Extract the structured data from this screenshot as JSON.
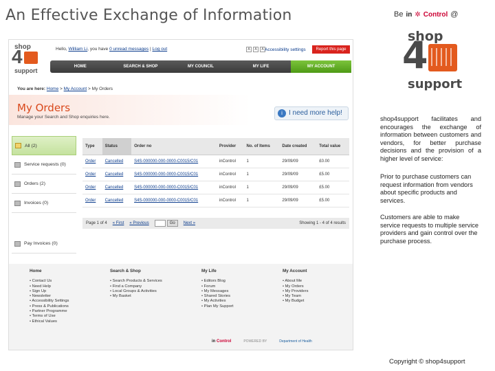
{
  "slide": {
    "title": "An Effective Exchange of Information",
    "be_prefix": "Be",
    "be_brand_in": "in",
    "be_brand_control": "Control",
    "be_suffix": "@",
    "logo_shop": "shop",
    "logo_four": "4",
    "logo_support": "support",
    "paragraphs": [
      "shop4support facilitates and encourages the exchange of information between customers and vendors, for better purchase decisions and the provision of a higher level of service:",
      "Prior to purchase customers can request information from vendors about specific products and services.",
      "Customers are able to make service requests to multiple service providers and gain control over the purchase process."
    ],
    "copyright": "Copyright © shop4support"
  },
  "site": {
    "logo_shop": "shop",
    "logo_four": "4",
    "logo_support": "support",
    "hello": "Hello,",
    "user": "William Li",
    "you_have": ", you have",
    "messages": "0 unread messages",
    "separator": "|",
    "logout": "Log out",
    "accessibility": "Accessibility settings",
    "report": "Report this page",
    "nav": [
      "HOME",
      "SEARCH & SHOP",
      "MY COUNCIL",
      "MY LIFE",
      "MY ACCOUNT"
    ],
    "nav_active": "MY ACCOUNT",
    "crumb_label": "You are here:",
    "crumb_home": "Home",
    "crumb_account": "My Account",
    "crumb_current": "My Orders",
    "page_title": "My Orders",
    "page_sub": "Manage your Search and Shop enquiries here.",
    "help": "I need more help!",
    "sidebar": [
      {
        "label": "All (2)",
        "active": true
      },
      {
        "label": "Service requests (0)",
        "active": false
      },
      {
        "label": "Orders (2)",
        "active": false
      },
      {
        "label": "Invoices (0)",
        "active": false
      }
    ],
    "pay_invoices": "Pay Invoices (0)",
    "table": {
      "headers": [
        "Type",
        "Status",
        "Order no",
        "Provider",
        "No. of Items",
        "Date created",
        "Total value"
      ],
      "rows": [
        [
          "Order",
          "Cancelled",
          "S4S-000000-000-0000-C0015/C01",
          "inControl",
          "1",
          "29/09/09",
          "£0.00"
        ],
        [
          "Order",
          "Cancelled",
          "S4S-000000-000-0000-C0015/C01",
          "inControl",
          "1",
          "29/09/09",
          "£5.00"
        ],
        [
          "Order",
          "Cancelled",
          "S4S-000000-000-0000-C0015/C01",
          "inControl",
          "1",
          "29/09/09",
          "£5.00"
        ],
        [
          "Order",
          "Cancelled",
          "S4S-000000-000-0000-C0015/C01",
          "inControl",
          "1",
          "29/09/09",
          "£5.00"
        ]
      ]
    },
    "pager": {
      "page": "Page 1 of 4",
      "first": "« First",
      "prev": "« Previous",
      "go": "Go",
      "next": "Next »",
      "results": "Showing 1 - 4 of 4 results"
    },
    "footer": [
      {
        "heading": "Home",
        "items": [
          "Contact Us",
          "Need Help",
          "Sign Up",
          "Newsletter",
          "Accessibility Settings",
          "Press & Publications",
          "Partner Programme",
          "Terms of Use",
          "Ethical Values"
        ]
      },
      {
        "heading": "Search & Shop",
        "items": [
          "Search Products & Services",
          "Find a Company",
          "Local Groups & Activities",
          "My Basket"
        ]
      },
      {
        "heading": "My Life",
        "items": [
          "Editors Blog",
          "Forum",
          "My Messages",
          "Shared Stories",
          "My Activities",
          "Plan My Support"
        ]
      },
      {
        "heading": "My Account",
        "items": [
          "About Me",
          "My Orders",
          "My Providers",
          "My Team",
          "My Budget"
        ]
      }
    ],
    "footer_logo_in": "in",
    "footer_logo_control": "Control",
    "footer_powered": "POWERED BY",
    "footer_dh": "Department of Health"
  }
}
